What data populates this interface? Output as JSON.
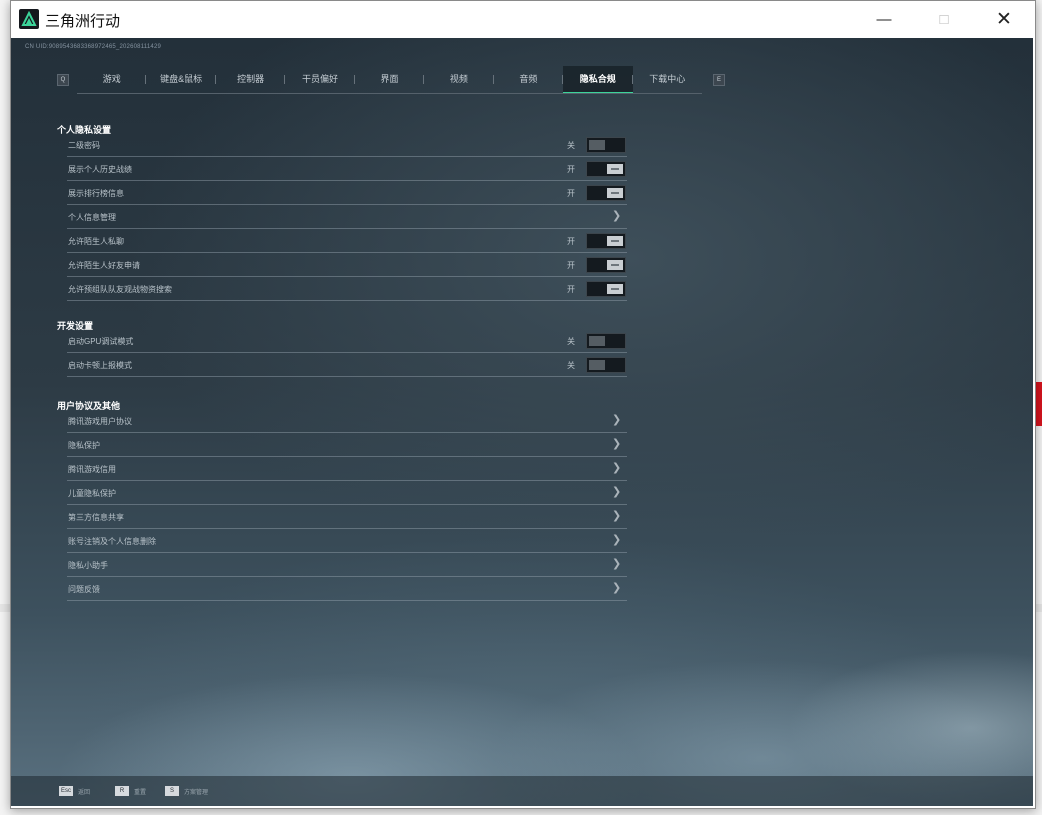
{
  "window": {
    "title": "三角洲行动"
  },
  "game": {
    "uid": "CN UID:9089543683368972465_202608111429",
    "tabs": [
      {
        "key": "game",
        "label": "游戏"
      },
      {
        "key": "keyboard",
        "label": "键盘&鼠标"
      },
      {
        "key": "controller",
        "label": "控制器"
      },
      {
        "key": "operator",
        "label": "干员偏好"
      },
      {
        "key": "interface",
        "label": "界面"
      },
      {
        "key": "video",
        "label": "视频"
      },
      {
        "key": "audio",
        "label": "音频"
      },
      {
        "key": "privacy",
        "label": "隐私合规",
        "active": true
      },
      {
        "key": "download",
        "label": "下载中心"
      }
    ],
    "tab_keys": {
      "prev": "Q",
      "next": "E"
    },
    "sections": {
      "personal": {
        "title": "个人隐私设置",
        "rows": [
          {
            "label": "二级密码",
            "state": "关",
            "toggle": "off"
          },
          {
            "label": "展示个人历史战绩",
            "state": "开",
            "toggle": "on"
          },
          {
            "label": "展示排行榜信息",
            "state": "开",
            "toggle": "on"
          },
          {
            "label": "个人信息管理",
            "chevron": true
          },
          {
            "label": "允许陌生人私聊",
            "state": "开",
            "toggle": "on"
          },
          {
            "label": "允许陌生人好友申请",
            "state": "开",
            "toggle": "on"
          },
          {
            "label": "允许预组队队友观战物资搜索",
            "state": "开",
            "toggle": "on"
          }
        ]
      },
      "dev": {
        "title": "开发设置",
        "rows": [
          {
            "label": "启动GPU调试模式",
            "state": "关",
            "toggle": "off"
          },
          {
            "label": "启动卡顿上报模式",
            "state": "关",
            "toggle": "off"
          }
        ]
      },
      "agreements": {
        "title": "用户协议及其他",
        "rows": [
          {
            "label": "腾讯游戏用户协议",
            "chevron": true
          },
          {
            "label": "隐私保护",
            "chevron": true
          },
          {
            "label": "腾讯游戏信用",
            "chevron": true
          },
          {
            "label": "儿童隐私保护",
            "chevron": true
          },
          {
            "label": "第三方信息共享",
            "chevron": true
          },
          {
            "label": "账号注销及个人信息删除",
            "chevron": true
          },
          {
            "label": "隐私小助手",
            "chevron": true
          },
          {
            "label": "问题反馈",
            "chevron": true
          }
        ]
      }
    },
    "footer": [
      {
        "key": "Esc",
        "label": "返回"
      },
      {
        "key": "R",
        "label": "重置"
      },
      {
        "key": "S",
        "label": "方案管理"
      }
    ]
  },
  "colors": {
    "accent": "#3cd49a",
    "bg": "#2d3b45"
  },
  "icons": {
    "app": "triangle-logo-icon",
    "chevron": "chevron-right-icon"
  }
}
